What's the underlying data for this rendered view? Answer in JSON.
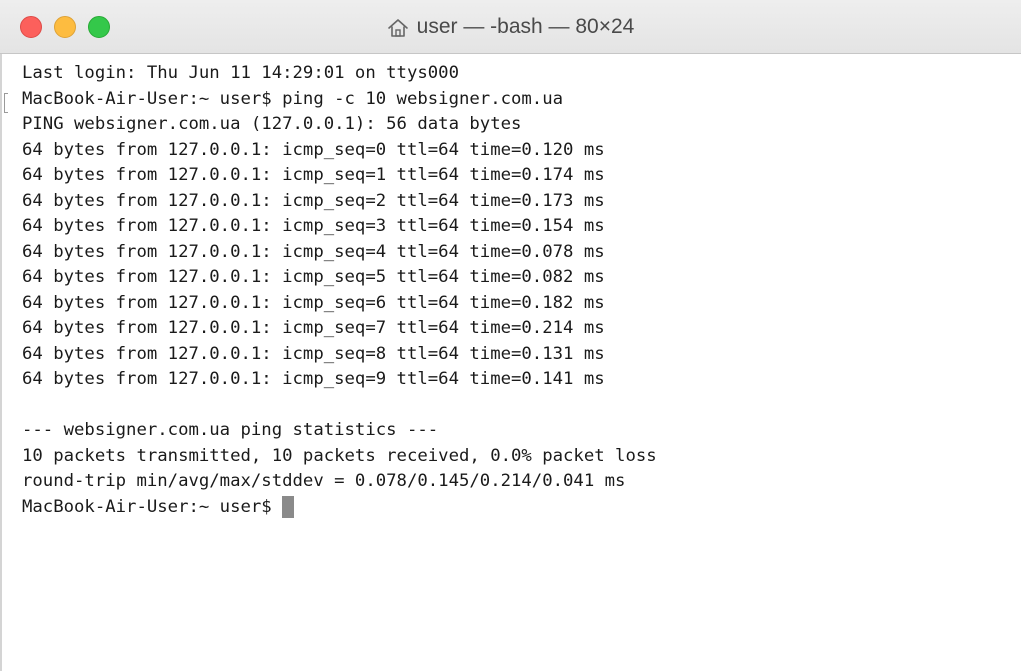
{
  "window": {
    "title": "user — -bash — 80×24",
    "title_icon": "home-icon"
  },
  "terminal": {
    "lines": [
      "Last login: Thu Jun 11 14:29:01 on ttys000",
      "MacBook-Air-User:~ user$ ping -c 10 websigner.com.ua",
      "PING websigner.com.ua (127.0.0.1): 56 data bytes",
      "64 bytes from 127.0.0.1: icmp_seq=0 ttl=64 time=0.120 ms",
      "64 bytes from 127.0.0.1: icmp_seq=1 ttl=64 time=0.174 ms",
      "64 bytes from 127.0.0.1: icmp_seq=2 ttl=64 time=0.173 ms",
      "64 bytes from 127.0.0.1: icmp_seq=3 ttl=64 time=0.154 ms",
      "64 bytes from 127.0.0.1: icmp_seq=4 ttl=64 time=0.078 ms",
      "64 bytes from 127.0.0.1: icmp_seq=5 ttl=64 time=0.082 ms",
      "64 bytes from 127.0.0.1: icmp_seq=6 ttl=64 time=0.182 ms",
      "64 bytes from 127.0.0.1: icmp_seq=7 ttl=64 time=0.214 ms",
      "64 bytes from 127.0.0.1: icmp_seq=8 ttl=64 time=0.131 ms",
      "64 bytes from 127.0.0.1: icmp_seq=9 ttl=64 time=0.141 ms",
      "",
      "--- websigner.com.ua ping statistics ---",
      "10 packets transmitted, 10 packets received, 0.0% packet loss",
      "round-trip min/avg/max/stddev = 0.078/0.145/0.214/0.041 ms"
    ],
    "prompt": "MacBook-Air-User:~ user$"
  },
  "colors": {
    "close": "#fc605c",
    "minimize": "#fdbc40",
    "zoom": "#34c84a",
    "text": "#1a1a1a",
    "cursor": "#8a8a8a"
  }
}
